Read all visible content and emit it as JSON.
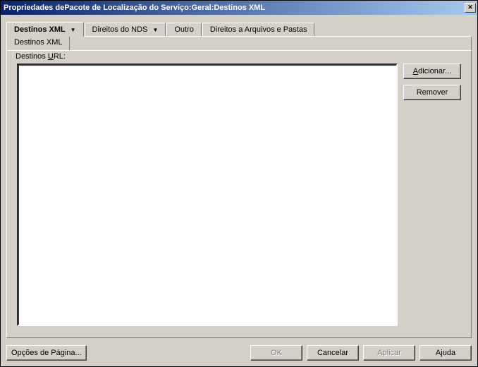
{
  "window": {
    "title": "Propriedades dePacote de Localização do Serviço:Geral:Destinos XML"
  },
  "tabs": {
    "items": [
      {
        "label": "Destinos XML",
        "active": true,
        "dropdown": true
      },
      {
        "label": "Direitos do NDS",
        "active": false,
        "dropdown": true
      },
      {
        "label": "Outro",
        "active": false,
        "dropdown": false
      },
      {
        "label": "Direitos a Arquivos e Pastas",
        "active": false,
        "dropdown": false
      }
    ]
  },
  "subtabs": {
    "items": [
      {
        "label": "Destinos XML",
        "active": true
      }
    ]
  },
  "panel": {
    "group_label_prefix": "Destinos ",
    "group_label_u": "U",
    "group_label_suffix": "RL:"
  },
  "side_buttons": {
    "add_prefix": "A",
    "add_suffix": "dicionar...",
    "remove": "Remover"
  },
  "bottom": {
    "page_options": "Opções de Página...",
    "ok": "OK",
    "cancel": "Cancelar",
    "apply": "Aplicar",
    "help": "Ajuda"
  }
}
